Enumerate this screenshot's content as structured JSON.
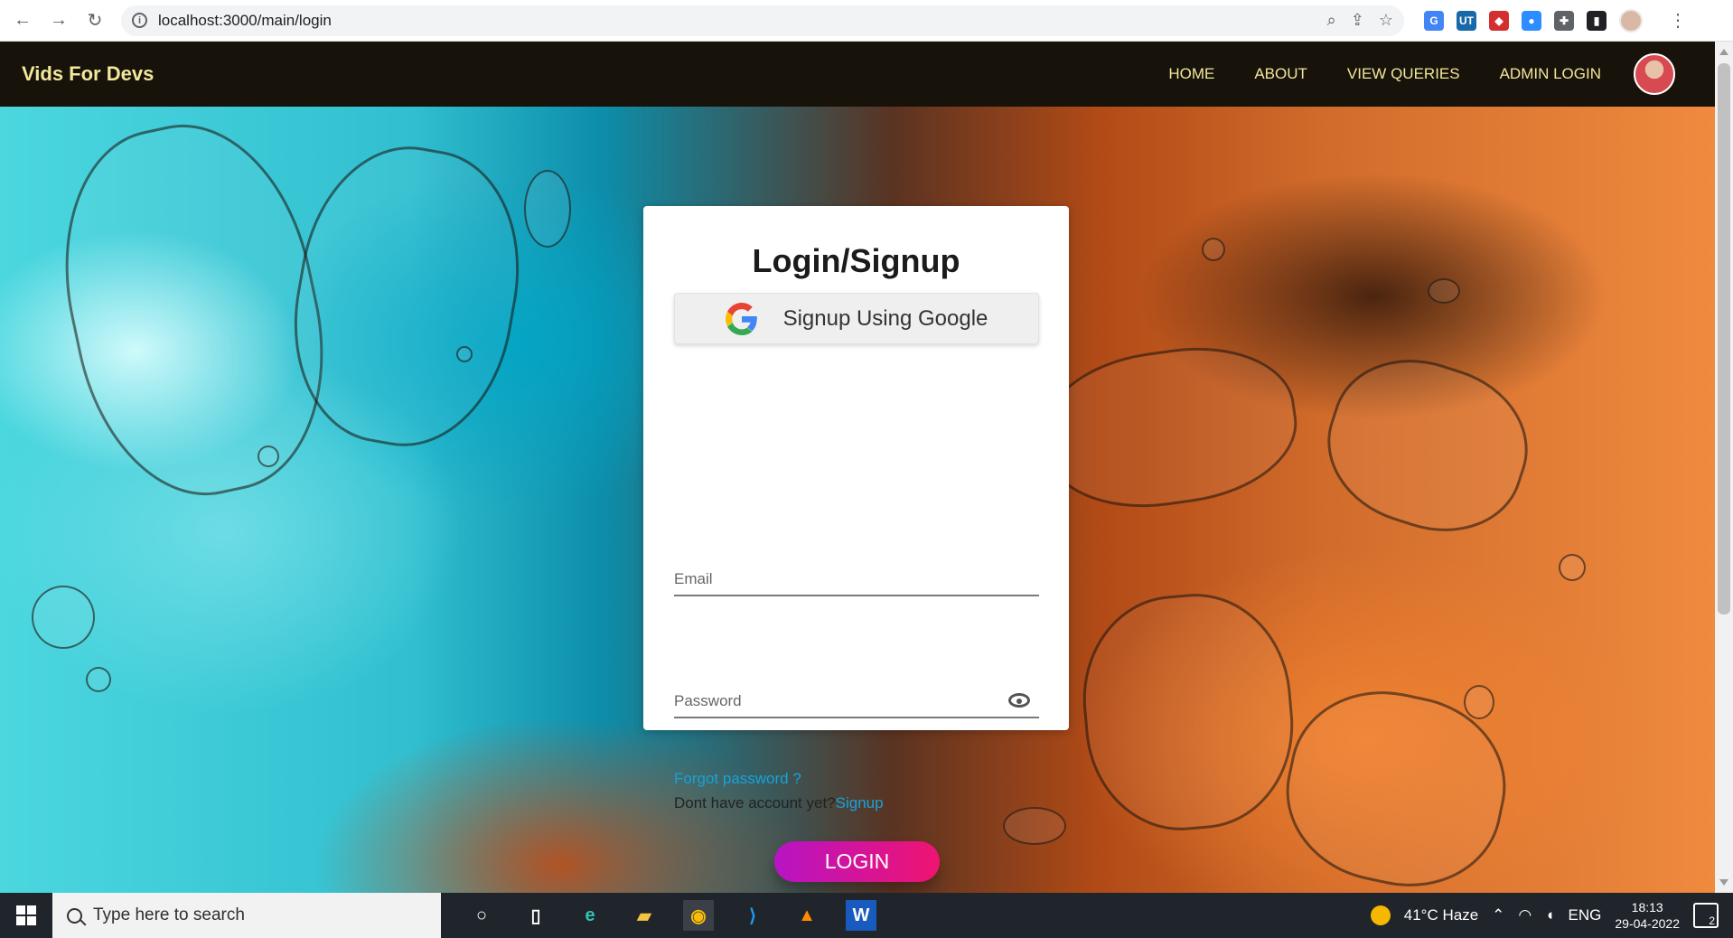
{
  "browser": {
    "url": "localhost:3000/main/login",
    "actions": [
      "zoom-icon",
      "share-icon",
      "bookmark-star-icon"
    ],
    "extensions": [
      {
        "name": "translate-extension-icon",
        "label": "G",
        "color": "#4285f4"
      },
      {
        "name": "ut-extension-icon",
        "label": "UT",
        "color": "#1769aa"
      },
      {
        "name": "red-extension-icon",
        "label": "◆",
        "color": "#d32f2f"
      },
      {
        "name": "zoom-extension-icon",
        "label": "●",
        "color": "#2d8cff"
      },
      {
        "name": "puzzle-icon",
        "label": "✚",
        "color": "#5f6368"
      },
      {
        "name": "sidebar-icon",
        "label": "▮",
        "color": "#202124"
      }
    ]
  },
  "app": {
    "brand": "Vids For Devs",
    "nav": [
      {
        "label": "HOME"
      },
      {
        "label": "ABOUT"
      },
      {
        "label": "VIEW QUERIES"
      },
      {
        "label": "ADMIN LOGIN"
      }
    ]
  },
  "login": {
    "title": "Login/Signup",
    "google_button": "Signup Using Google",
    "email_placeholder": "Email",
    "password_placeholder": "Password",
    "forgot_password": "Forgot password ?",
    "signup_prompt": "Dont have account yet?",
    "signup_link": "Signup",
    "login_button": "LOGIN"
  },
  "taskbar": {
    "search_placeholder": "Type here to search",
    "weather": "41°C  Haze",
    "language": "ENG",
    "time": "18:13",
    "date": "29-04-2022",
    "notifications": "2"
  }
}
